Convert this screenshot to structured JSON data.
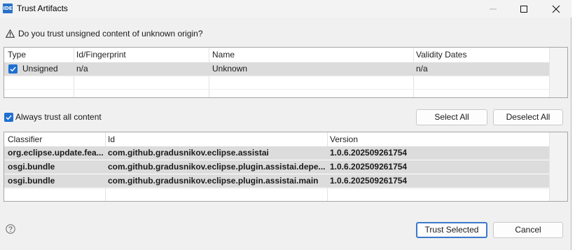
{
  "window": {
    "app_icon_text": "IDE",
    "title": "Trust Artifacts"
  },
  "question": "Do you trust unsigned content of unknown origin?",
  "trust_table": {
    "headers": [
      "Type",
      "Id/Fingerprint",
      "Name",
      "Validity Dates"
    ],
    "rows": [
      {
        "checked": true,
        "type": "Unsigned",
        "id": "n/a",
        "name": "Unknown",
        "validity": "n/a"
      }
    ]
  },
  "always_trust": {
    "checked": true,
    "label": "Always trust all content"
  },
  "select_all_label": "Select All",
  "deselect_all_label": "Deselect All",
  "artifact_table": {
    "headers": [
      "Classifier",
      "Id",
      "Version"
    ],
    "rows": [
      {
        "classifier": "org.eclipse.update.fea...",
        "id": "com.github.gradusnikov.eclipse.assistai",
        "version": "1.0.6.202509261754"
      },
      {
        "classifier": "osgi.bundle",
        "id": "com.github.gradusnikov.eclipse.plugin.assistai.depe...",
        "version": "1.0.6.202509261754"
      },
      {
        "classifier": "osgi.bundle",
        "id": "com.github.gradusnikov.eclipse.plugin.assistai.main",
        "version": "1.0.6.202509261754"
      }
    ]
  },
  "trust_selected_label": "Trust Selected",
  "cancel_label": "Cancel",
  "colors": {
    "accent": "#1f6fd1",
    "selection": "#dcdcdc",
    "dialog_bg": "#f0f0f0"
  }
}
